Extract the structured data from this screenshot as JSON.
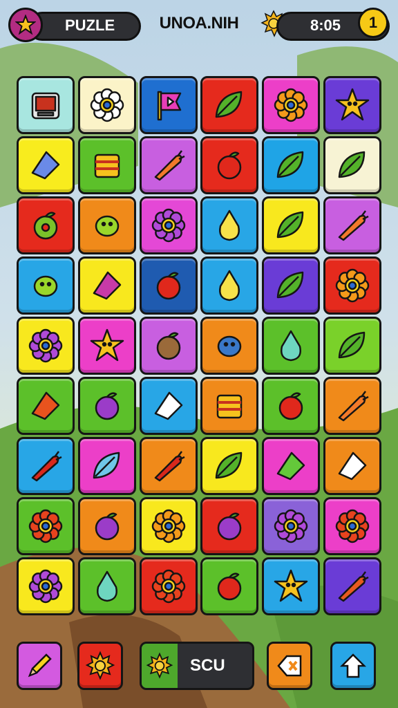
{
  "hud": {
    "left_label": "PUZLE",
    "title": "UNOA.NIH",
    "timer": "8:05",
    "coin_glyph": "1"
  },
  "icons": {
    "star_badge": "star-icon",
    "sun_hud": "sun-icon",
    "coin": "coin-icon"
  },
  "grid": {
    "rows": 9,
    "cols": 6,
    "tiles": [
      {
        "color": "#a8e6e0",
        "icon": "radio-icon"
      },
      {
        "color": "#fbf3c8",
        "icon": "flower-white-icon"
      },
      {
        "color": "#1f6fd0",
        "icon": "flag-icon"
      },
      {
        "color": "#e52a1d",
        "icon": "leaf-arrow-icon"
      },
      {
        "color": "#ec3fc8",
        "icon": "flower-orange-icon"
      },
      {
        "color": "#6a3cd6",
        "icon": "hand-icon"
      },
      {
        "color": "#f8ec1e",
        "icon": "lollipop-icon"
      },
      {
        "color": "#5cc02a",
        "icon": "cracker-icon"
      },
      {
        "color": "#c85fe0",
        "icon": "carrot-icon"
      },
      {
        "color": "#e52a1d",
        "icon": "berry-red-icon"
      },
      {
        "color": "#1fa4e6",
        "icon": "pea-icon"
      },
      {
        "color": "#f7f3d4",
        "icon": "ladybug-leaf-icon"
      },
      {
        "color": "#e52a1d",
        "icon": "donut-icon"
      },
      {
        "color": "#f08a1a",
        "icon": "shell-icon"
      },
      {
        "color": "#e448d6",
        "icon": "flower-purple-icon"
      },
      {
        "color": "#28a6e6",
        "icon": "lemon-icon"
      },
      {
        "color": "#f8e81e",
        "icon": "pear-orange-icon"
      },
      {
        "color": "#c85fe0",
        "icon": "candy-icon"
      },
      {
        "color": "#28a6e6",
        "icon": "cactus-icon"
      },
      {
        "color": "#f8e81e",
        "icon": "purse-icon"
      },
      {
        "color": "#1f5bb0",
        "icon": "tomato-icon"
      },
      {
        "color": "#28a6e6",
        "icon": "bottle-icon"
      },
      {
        "color": "#6a3cd6",
        "icon": "lemon-leaf-icon"
      },
      {
        "color": "#e52a1d",
        "icon": "sunflower-icon"
      },
      {
        "color": "#f8e81e",
        "icon": "flower-magenta-icon"
      },
      {
        "color": "#ec3fc8",
        "icon": "starfish-icon"
      },
      {
        "color": "#c85fe0",
        "icon": "onion-icon"
      },
      {
        "color": "#f08a1a",
        "icon": "beetle-icon"
      },
      {
        "color": "#5cc02a",
        "icon": "potion-icon"
      },
      {
        "color": "#7ad12a",
        "icon": "pickle-icon"
      },
      {
        "color": "#5cc02a",
        "icon": "paper-plane-icon"
      },
      {
        "color": "#5cc02a",
        "icon": "eggplant-icon"
      },
      {
        "color": "#28a6e6",
        "icon": "petal-icon"
      },
      {
        "color": "#f08a1a",
        "icon": "cake-icon"
      },
      {
        "color": "#5cc02a",
        "icon": "apple-icon"
      },
      {
        "color": "#f08a1a",
        "icon": "popsicle-icon"
      },
      {
        "color": "#28a6e6",
        "icon": "radish-icon"
      },
      {
        "color": "#ec3fc8",
        "icon": "leaf-blue-icon"
      },
      {
        "color": "#f08a1a",
        "icon": "chili-icon"
      },
      {
        "color": "#f8e81e",
        "icon": "pear-icon"
      },
      {
        "color": "#ec3fc8",
        "icon": "wrench-icon"
      },
      {
        "color": "#f08a1a",
        "icon": "splat-icon"
      },
      {
        "color": "#5cc02a",
        "icon": "flower-red-icon"
      },
      {
        "color": "#f08a1a",
        "icon": "plum-icon"
      },
      {
        "color": "#f8e81e",
        "icon": "sunflower-small-icon"
      },
      {
        "color": "#e52a1d",
        "icon": "grape-icon"
      },
      {
        "color": "#8a62d8",
        "icon": "flower-lilac-icon"
      },
      {
        "color": "#ec3fc8",
        "icon": "flower-fire-icon"
      },
      {
        "color": "#f8e81e",
        "icon": "flower-pink-icon"
      },
      {
        "color": "#5cc02a",
        "icon": "gourd-icon"
      },
      {
        "color": "#e52a1d",
        "icon": "sunflower-red-icon"
      },
      {
        "color": "#5cc02a",
        "icon": "apple-red-icon"
      },
      {
        "color": "#28a6e6",
        "icon": "chick-icon"
      },
      {
        "color": "#6a3cd6",
        "icon": "pineapple-icon"
      }
    ]
  },
  "bottom": {
    "score_label": "SCU",
    "buttons": [
      {
        "name": "pencil-button",
        "icon": "pencil-icon",
        "color": "#d35ae0"
      },
      {
        "name": "sun-button",
        "icon": "sun-icon",
        "color": "#e52a1d"
      },
      {
        "name": "back-button",
        "icon": "back-icon",
        "color": "#f08a1a"
      },
      {
        "name": "home-button",
        "icon": "home-arrow-icon",
        "color": "#28a6e6"
      }
    ]
  }
}
